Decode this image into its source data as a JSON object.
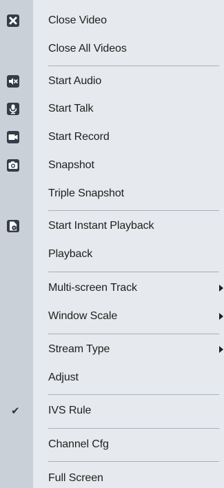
{
  "menu": {
    "items": [
      {
        "label": "Close Video",
        "icon": "close-icon"
      },
      {
        "label": "Close All Videos"
      },
      {
        "label": "Start Audio",
        "icon": "speaker-icon"
      },
      {
        "label": "Start Talk",
        "icon": "microphone-icon"
      },
      {
        "label": "Start Record",
        "icon": "record-icon"
      },
      {
        "label": "Snapshot",
        "icon": "camera-icon"
      },
      {
        "label": "Triple Snapshot"
      },
      {
        "label": "Start Instant Playback",
        "icon": "instant-playback-icon"
      },
      {
        "label": "Playback"
      },
      {
        "label": "Multi-screen Track",
        "submenu": true
      },
      {
        "label": "Window Scale",
        "submenu": true
      },
      {
        "label": "Stream Type",
        "submenu": true
      },
      {
        "label": "Adjust"
      },
      {
        "label": "IVS Rule",
        "checked": true
      },
      {
        "label": "Channel Cfg"
      },
      {
        "label": "Full Screen"
      }
    ]
  },
  "colors": {
    "menu_background": "#e6e9ed",
    "icon_gutter": "#c9d0d8",
    "icon_fill": "#333d48",
    "separator": "#a9b0b8",
    "text": "#1f1f1f"
  }
}
